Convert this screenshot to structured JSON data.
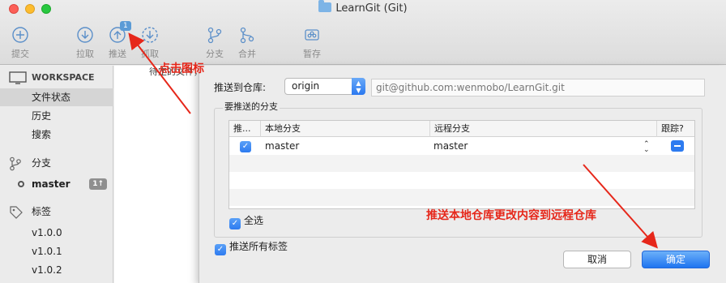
{
  "window": {
    "title": "LearnGit (Git)"
  },
  "toolbar": {
    "commit": "提交",
    "pull": "拉取",
    "push": "推送",
    "push_badge": "1",
    "fetch": "抓取",
    "branch": "分支",
    "merge": "合并",
    "stash": "暂存"
  },
  "sidebar": {
    "workspace": "WORKSPACE",
    "file_status": "文件状态",
    "history": "历史",
    "search": "搜索",
    "branches": "分支",
    "master": "master",
    "master_badge": "1↑",
    "tags": "标签",
    "tag_items": [
      "v1.0.0",
      "v1.0.1",
      "v1.0.2"
    ]
  },
  "background": {
    "filter_hint": "待定的文件，"
  },
  "dialog": {
    "push_to_repo_label": "推送到仓库:",
    "remote": "origin",
    "remote_url": "git@github.com:wenmobo/LearnGit.git",
    "branches_group_title": "要推送的分支",
    "columns": {
      "push": "推...",
      "local": "本地分支",
      "remote": "远程分支",
      "track": "跟踪?"
    },
    "rows": [
      {
        "local": "master",
        "remote": "master",
        "push": true,
        "track": true
      }
    ],
    "select_all": "全选",
    "push_all_tags": "推送所有标签",
    "cancel": "取消",
    "ok": "确定"
  },
  "annotations": {
    "click_icon": "点击图标",
    "push_note": "推送本地仓库更改内容到远程仓库",
    "color": "#e6271a"
  },
  "colors": {
    "accent": "#2d7bf0"
  }
}
